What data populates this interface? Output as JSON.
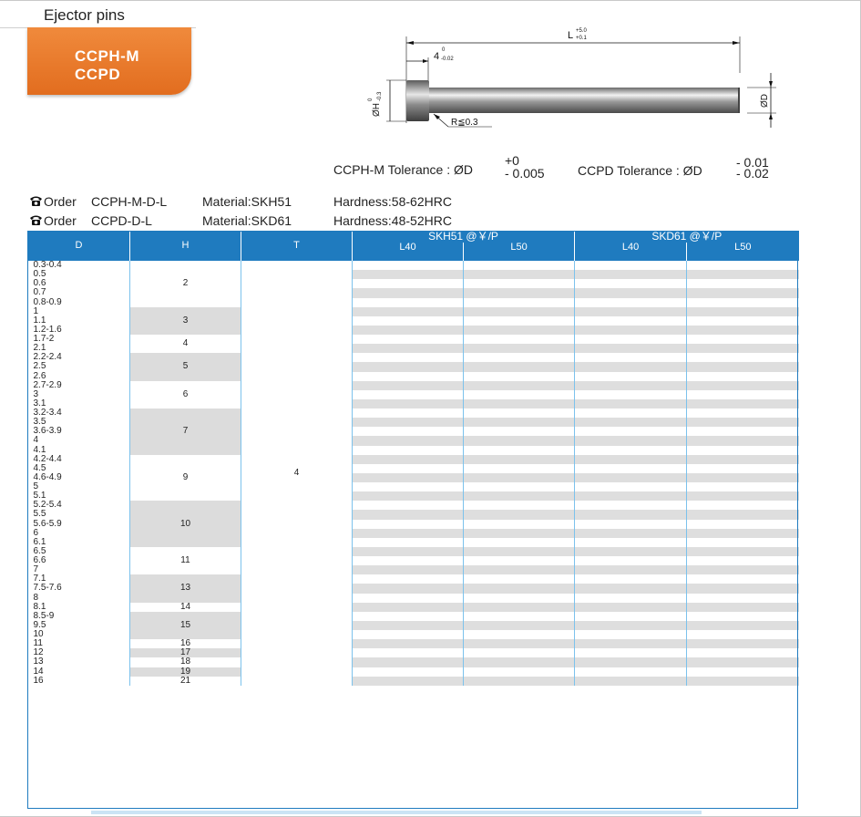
{
  "header": {
    "section_title": "Ejector pins",
    "models": [
      "CCPH-M",
      "CCPD"
    ]
  },
  "drawing": {
    "length_label": "L",
    "length_tol_upper": "+5.0",
    "length_tol_lower": "+0.1",
    "head_len": "4",
    "head_len_tol_upper": "0",
    "head_len_tol_lower": "-0.02",
    "head_dia": "ØH",
    "head_dia_tol_upper": "0",
    "head_dia_tol_lower": "-0.3",
    "radius": "R≦0.3",
    "shaft_dia": "ØD"
  },
  "tolerance": {
    "ccph_label": "CCPH-M  Tolerance : ØD",
    "ccph_upper": "+0",
    "ccph_lower": "- 0.005",
    "ccpd_label": "CCPD  Tolerance : ØD",
    "ccpd_upper": "- 0.01",
    "ccpd_lower": "- 0.02"
  },
  "orders": [
    {
      "order": "Order",
      "code": "CCPH-M-D-L",
      "material": "Material:SKH51",
      "hardness": "Hardness:58-62HRC"
    },
    {
      "order": "Order",
      "code": "CCPD-D-L",
      "material": "Material:SKD61",
      "hardness": "Hardness:48-52HRC"
    }
  ],
  "table": {
    "headers": {
      "d": "D",
      "h": "H",
      "t": "T",
      "skh51": "SKH51 @￥/P",
      "skd61": "SKD61 @￥/P",
      "l40": "L40",
      "l50": "L50"
    },
    "d_values": [
      "0.3-0.4",
      "0.5",
      "0.6",
      "0.7",
      "0.8-0.9",
      "1",
      "1.1",
      "1.2-1.6",
      "1.7-2",
      "2.1",
      "2.2-2.4",
      "2.5",
      "2.6",
      "2.7-2.9",
      "3",
      "3.1",
      "3.2-3.4",
      "3.5",
      "3.6-3.9",
      "4",
      "4.1",
      "4.2-4.4",
      "4.5",
      "4.6-4.9",
      "5",
      "5.1",
      "5.2-5.4",
      "5.5",
      "5.6-5.9",
      "6",
      "6.1",
      "6.5",
      "6.6",
      "7",
      "7.1",
      "7.5-7.6",
      "8",
      "8.1",
      "8.5-9",
      "9.5",
      "10",
      "11",
      "12",
      "13",
      "14",
      "16"
    ],
    "h_groups": [
      {
        "value": "2",
        "rows": 5
      },
      {
        "value": "3",
        "rows": 3
      },
      {
        "value": "4",
        "rows": 2
      },
      {
        "value": "5",
        "rows": 3
      },
      {
        "value": "6",
        "rows": 3
      },
      {
        "value": "7",
        "rows": 5
      },
      {
        "value": "9",
        "rows": 5
      },
      {
        "value": "10",
        "rows": 5
      },
      {
        "value": "11",
        "rows": 3
      },
      {
        "value": "13",
        "rows": 3
      },
      {
        "value": "14",
        "rows": 1
      },
      {
        "value": "15",
        "rows": 3
      },
      {
        "value": "16",
        "rows": 1
      },
      {
        "value": "17",
        "rows": 1
      },
      {
        "value": "18",
        "rows": 1
      },
      {
        "value": "19",
        "rows": 1
      },
      {
        "value": "21",
        "rows": 1
      }
    ],
    "t_value": "4"
  },
  "colors": {
    "header_blue": "#1f7bbf",
    "accent_orange": "#ea7a2c",
    "row_grey": "#dedede"
  }
}
